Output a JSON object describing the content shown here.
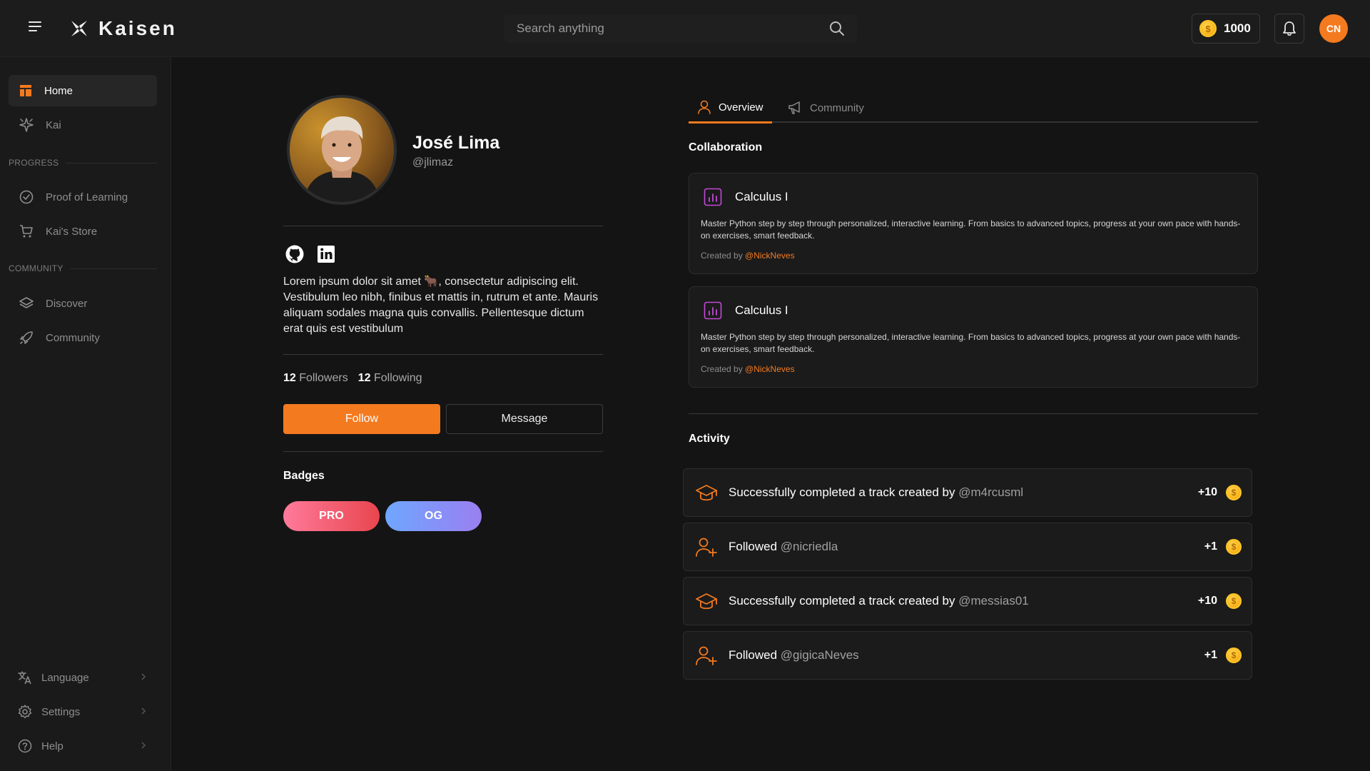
{
  "header": {
    "brand": "Kaisen",
    "search_placeholder": "Search anything",
    "coins": "1000",
    "avatar_initials": "CN",
    "colors": {
      "accent": "#f47a1f",
      "coin": "#f5a300"
    }
  },
  "sidebar": {
    "top_items": [
      {
        "label": "Home",
        "icon": "home-icon"
      },
      {
        "label": "Kai",
        "icon": "sparkle-icon"
      }
    ],
    "progress_label": "PROGRESS",
    "progress_items": [
      {
        "label": "Proof of Learning",
        "icon": "check-circle-icon"
      },
      {
        "label": "Kai's Store",
        "icon": "cart-icon"
      }
    ],
    "community_label": "COMMUNITY",
    "community_items": [
      {
        "label": "Discover",
        "icon": "layers-icon"
      },
      {
        "label": "Community",
        "icon": "rocket-icon"
      }
    ],
    "bottom_items": [
      {
        "label": "Language",
        "icon": "translate-icon"
      },
      {
        "label": "Settings",
        "icon": "gear-icon"
      },
      {
        "label": "Help",
        "icon": "help-icon"
      }
    ]
  },
  "profile": {
    "name": "José Lima",
    "handle": "@jlimaz",
    "bio": "Lorem ipsum dolor sit amet 🐂, consectetur adipiscing elit. Vestibulum leo nibh, finibus et mattis in, rutrum et ante. Mauris aliquam sodales magna quis convallis. Pellentesque dictum erat quis est vestibulum",
    "followers_count": "12",
    "followers_label": "Followers",
    "following_count": "12",
    "following_label": "Following",
    "follow_button": "Follow",
    "message_button": "Message",
    "badges_title": "Badges",
    "badges": [
      "PRO",
      "OG"
    ]
  },
  "tabs": [
    {
      "label": "Overview",
      "active": true
    },
    {
      "label": "Community",
      "active": false
    }
  ],
  "collaboration": {
    "title": "Collaboration",
    "cards": [
      {
        "title": "Calculus I",
        "description": "Master Python step by step through personalized, interactive learning. From basics to advanced topics, progress at your own pace with hands-on exercises, smart feedback.",
        "created_by_label": "Created by",
        "author": "@NickNeves"
      },
      {
        "title": "Calculus I",
        "description": "Master Python step by step through personalized, interactive learning. From basics to advanced topics, progress at your own pace with hands-on exercises, smart feedback.",
        "created_by_label": "Created by",
        "author": "@NickNeves"
      }
    ]
  },
  "activity": {
    "title": "Activity",
    "items": [
      {
        "text": "Successfully completed a track created by",
        "user": "@m4rcusml",
        "points": "+10",
        "icon": "graduation-cap-icon"
      },
      {
        "text": "Followed",
        "user": "@nicriedla",
        "points": "+1",
        "icon": "user-plus-icon"
      },
      {
        "text": "Successfully completed a track created by",
        "user": "@messias01",
        "points": "+10",
        "icon": "graduation-cap-icon"
      },
      {
        "text": "Followed",
        "user": "@gigicaNeves",
        "points": "+1",
        "icon": "user-plus-icon"
      }
    ]
  }
}
